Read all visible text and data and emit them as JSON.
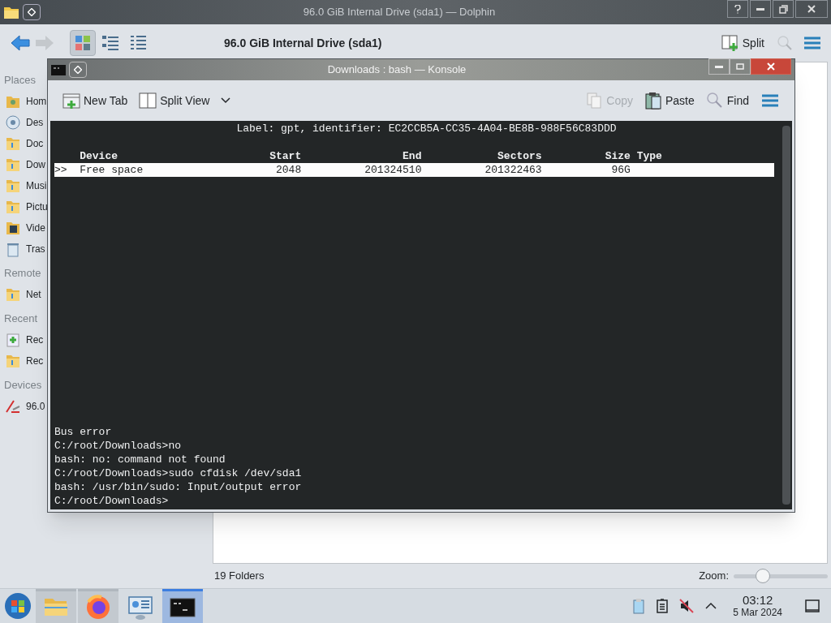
{
  "dolphin": {
    "title": "96.0 GiB Internal Drive (sda1) — Dolphin",
    "view_modes": [
      {
        "kind": "icons",
        "selected": true
      },
      {
        "kind": "details",
        "selected": false
      },
      {
        "kind": "compact",
        "selected": false
      }
    ],
    "location": "96.0 GiB Internal Drive (sda1)",
    "split": "Split",
    "places": [
      {
        "heading": "Places",
        "items": [
          {
            "label": "Hom",
            "kind": "home"
          },
          {
            "label": "Des",
            "kind": "desktop"
          },
          {
            "label": "Doc",
            "kind": "folder"
          },
          {
            "label": "Dow",
            "kind": "folder"
          },
          {
            "label": "Musi",
            "kind": "folder"
          },
          {
            "label": "Pictu",
            "kind": "folder"
          },
          {
            "label": "Vide",
            "kind": "video"
          },
          {
            "label": "Tras",
            "kind": "trash"
          }
        ]
      },
      {
        "heading": "Remote",
        "items": [
          {
            "label": "Net",
            "kind": "folder"
          }
        ]
      },
      {
        "heading": "Recent",
        "items": [
          {
            "label": "Rec",
            "kind": "recent"
          },
          {
            "label": "Rec",
            "kind": "folder"
          }
        ]
      },
      {
        "heading": "Devices",
        "items": [
          {
            "label": "96.0",
            "kind": "drive"
          }
        ]
      }
    ],
    "status": "19 Folders",
    "zoom": {
      "label": "Zoom:",
      "level": 0.28
    }
  },
  "konsole": {
    "title": "Downloads : bash — Konsole",
    "toolbar": [
      {
        "label": "New Tab",
        "kind": "newtab",
        "disabled": false
      },
      {
        "label": "Split View",
        "kind": "split",
        "disabled": false
      },
      {
        "label": "Copy",
        "kind": "copy",
        "disabled": true
      },
      {
        "label": "Paste",
        "kind": "paste",
        "disabled": false
      },
      {
        "label": "Find",
        "kind": "find",
        "disabled": false
      }
    ],
    "label_line": "Label: gpt, identifier: EC2CCB5A-CC35-4A04-BE8B-988F56C83DDD",
    "columns": [
      "Device",
      "Start",
      "End",
      "Sectors",
      "Size",
      "Type"
    ],
    "rows": [
      {
        "marker": ">>",
        "cells": [
          "Free space",
          "2048",
          "201324510",
          "201322463",
          "96G"
        ],
        "selected": true
      }
    ],
    "output": [
      "Bus error",
      "C:/root/Downloads>no",
      "bash: no: command not found",
      "C:/root/Downloads>sudo cfdisk /dev/sda1",
      "bash: /usr/bin/sudo: Input/output error",
      "C:/root/Downloads>"
    ]
  },
  "taskbar": {
    "apps": [
      {
        "kind": "files",
        "running": true,
        "selected": false
      },
      {
        "kind": "browser",
        "running": true,
        "selected": false
      },
      {
        "kind": "settings",
        "running": false,
        "selected": false
      },
      {
        "kind": "terminal",
        "running": true,
        "selected": true
      }
    ],
    "time": "03:12",
    "date": "5 Mar 2024"
  }
}
